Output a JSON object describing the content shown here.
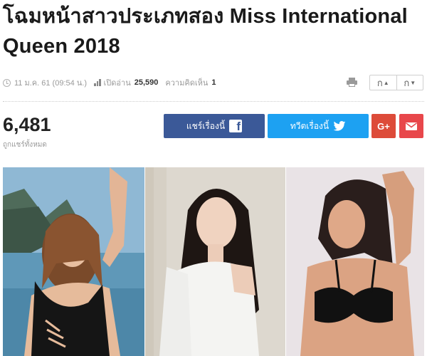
{
  "article": {
    "title": "โฉมหน้าสาวประเภทสอง Miss International Queen 2018"
  },
  "meta": {
    "date": "11 ม.ค. 61 (09:54 น.)",
    "views_label": "เปิดอ่าน",
    "views": "25,590",
    "comments_label": "ความคิดเห็น",
    "comments": "1"
  },
  "font_controls": {
    "increase_label": "ก",
    "decrease_label": "ก"
  },
  "share": {
    "count": "6,481",
    "count_label": "ถูกแชร์ทั้งหมด",
    "facebook_label": "แชร์เรื่องนี้",
    "twitter_label": "ทวีตเรื่องนี้",
    "googleplus_label": "G+"
  },
  "colors": {
    "facebook": "#3b5998",
    "twitter": "#1da1f2",
    "googleplus": "#dd4b39",
    "mail": "#e8474b"
  },
  "icons": [
    "clock-icon",
    "bar-chart-icon",
    "print-icon",
    "facebook-icon",
    "twitter-icon",
    "googleplus-icon",
    "mail-icon"
  ]
}
